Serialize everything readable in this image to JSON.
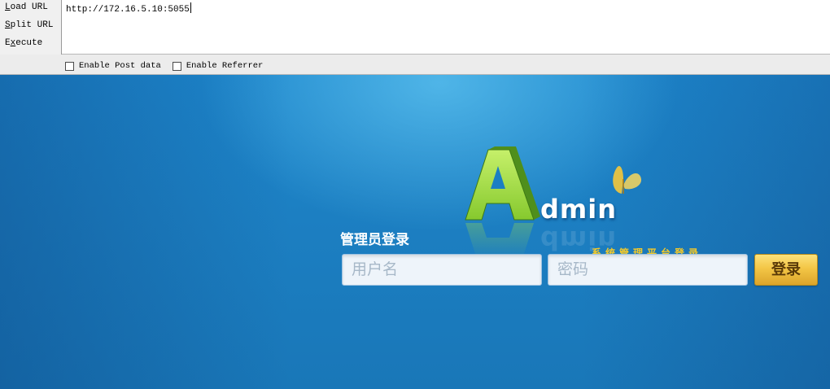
{
  "hackbar": {
    "buttons": [
      {
        "label_prefix": "",
        "label_accel": "L",
        "label_rest": "oad URL"
      },
      {
        "label_prefix": "",
        "label_accel": "S",
        "label_rest": "plit URL"
      },
      {
        "label_prefix": "E",
        "label_accel": "x",
        "label_rest": "ecute"
      }
    ],
    "url_value": "http://172.16.5.10:5055",
    "options": [
      {
        "label": "Enable Post data",
        "checked": false
      },
      {
        "label": "Enable Referrer",
        "checked": false
      }
    ]
  },
  "logo": {
    "letter": "A",
    "rest": "dmin",
    "subtitle": "系统管理平台登录",
    "colors": {
      "letter": "#9ad63c",
      "subtitle": "#f4c92a",
      "butterfly": "#f6c83a"
    }
  },
  "login": {
    "title": "管理员登录",
    "username_placeholder": "用户名",
    "password_placeholder": "密码",
    "submit_label": "登录"
  },
  "colors": {
    "background": "#1c7fc2",
    "button": "#f3c646"
  }
}
